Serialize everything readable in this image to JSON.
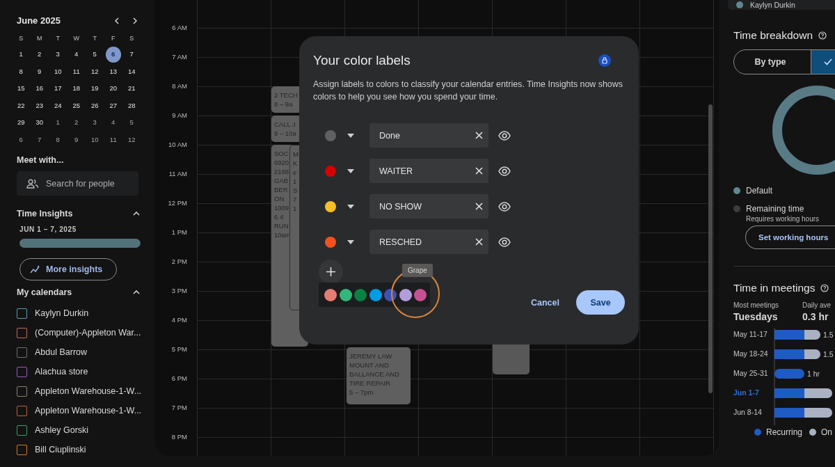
{
  "mini_calendar": {
    "month": "June 2025",
    "weekdays": [
      "S",
      "M",
      "T",
      "W",
      "T",
      "F",
      "S"
    ],
    "days": [
      {
        "label": "1",
        "selected": false,
        "muted": false
      },
      {
        "label": "2",
        "selected": false,
        "muted": false
      },
      {
        "label": "3",
        "selected": false,
        "muted": false
      },
      {
        "label": "4",
        "selected": false,
        "muted": false
      },
      {
        "label": "5",
        "selected": false,
        "muted": false
      },
      {
        "label": "6",
        "selected": true,
        "muted": false
      },
      {
        "label": "7",
        "selected": false,
        "muted": false
      },
      {
        "label": "8",
        "selected": false,
        "muted": false
      },
      {
        "label": "9",
        "selected": false,
        "muted": false
      },
      {
        "label": "10",
        "selected": false,
        "muted": false
      },
      {
        "label": "11",
        "selected": false,
        "muted": false
      },
      {
        "label": "12",
        "selected": false,
        "muted": false
      },
      {
        "label": "13",
        "selected": false,
        "muted": false
      },
      {
        "label": "14",
        "selected": false,
        "muted": false
      },
      {
        "label": "15",
        "selected": false,
        "muted": false
      },
      {
        "label": "16",
        "selected": false,
        "muted": false
      },
      {
        "label": "17",
        "selected": false,
        "muted": false
      },
      {
        "label": "18",
        "selected": false,
        "muted": false
      },
      {
        "label": "19",
        "selected": false,
        "muted": false
      },
      {
        "label": "20",
        "selected": false,
        "muted": false
      },
      {
        "label": "21",
        "selected": false,
        "muted": false
      },
      {
        "label": "22",
        "selected": false,
        "muted": false
      },
      {
        "label": "23",
        "selected": false,
        "muted": false
      },
      {
        "label": "24",
        "selected": false,
        "muted": false
      },
      {
        "label": "25",
        "selected": false,
        "muted": false
      },
      {
        "label": "26",
        "selected": false,
        "muted": false
      },
      {
        "label": "27",
        "selected": false,
        "muted": false
      },
      {
        "label": "28",
        "selected": false,
        "muted": false
      },
      {
        "label": "29",
        "selected": false,
        "muted": false
      },
      {
        "label": "30",
        "selected": false,
        "muted": false
      },
      {
        "label": "1",
        "selected": false,
        "muted": true
      },
      {
        "label": "2",
        "selected": false,
        "muted": true
      },
      {
        "label": "3",
        "selected": false,
        "muted": true
      },
      {
        "label": "4",
        "selected": false,
        "muted": true
      },
      {
        "label": "5",
        "selected": false,
        "muted": true
      },
      {
        "label": "6",
        "selected": false,
        "muted": true
      },
      {
        "label": "7",
        "selected": false,
        "muted": true
      },
      {
        "label": "8",
        "selected": false,
        "muted": true
      },
      {
        "label": "9",
        "selected": false,
        "muted": true
      },
      {
        "label": "10",
        "selected": false,
        "muted": true
      },
      {
        "label": "11",
        "selected": false,
        "muted": true
      },
      {
        "label": "12",
        "selected": false,
        "muted": true
      }
    ]
  },
  "meet_with": {
    "title": "Meet with...",
    "placeholder": "Search for people"
  },
  "time_insights": {
    "title": "Time Insights",
    "expanded": true,
    "range": "JUN 1 – 7, 2025",
    "level": 1,
    "button": "More insights"
  },
  "my_calendars": {
    "title": "My calendars",
    "expanded": true,
    "items": [
      {
        "name": "Kaylyn Durkin",
        "color": "#5e9cb0",
        "checked": false
      },
      {
        "name": "(Computer)-Appleton War...",
        "color": "#c0705a",
        "checked": false
      },
      {
        "name": "Abdul Barrow",
        "color": "#6f6f6f",
        "checked": false
      },
      {
        "name": "Alachua store",
        "color": "#9c5bb8",
        "checked": false
      },
      {
        "name": "Appleton Warehouse-1-W...",
        "color": "#8a8070",
        "checked": false
      },
      {
        "name": "Appleton Warehouse-1-W...",
        "color": "#c0603a",
        "checked": false
      },
      {
        "name": "Ashley Gorski",
        "color": "#3f9a6a",
        "checked": false
      },
      {
        "name": "Bill Ciuplinski",
        "color": "#d07a30",
        "checked": false
      }
    ]
  },
  "time_grid": {
    "hours": [
      "6 AM",
      "7 AM",
      "8 AM",
      "9 AM",
      "10 AM",
      "11 AM",
      "12 PM",
      "1 PM",
      "2 PM",
      "3 PM",
      "4 PM",
      "5 PM",
      "6 PM",
      "7 PM",
      "8 PM"
    ],
    "events": [
      {
        "lines": [
          "2 TECH",
          "8 – 9a"
        ]
      },
      {
        "lines": [
          "CALL J",
          "9 – 10a"
        ]
      },
      {
        "lines": [
          "SOC",
          "6920",
          "2198",
          "GAB",
          "BER",
          "ON",
          "1009",
          "6 4",
          "RUN",
          "10am"
        ]
      },
      {
        "lines": [
          "M",
          "K",
          "e",
          "1",
          "S",
          "7",
          "1"
        ]
      },
      {
        "lines": [
          "JEREMY LAW MOUNT AND BALLANCE AND TIRE REPAIR",
          "5 – 7pm"
        ]
      },
      {
        "kind": "blank"
      }
    ]
  },
  "dialog": {
    "title": "Your color labels",
    "description": "Assign labels to colors to classify your calendar entries. Time Insights now shows colors to help you see how you spend your time.",
    "labels": [
      {
        "color": "#616161",
        "value": "Done"
      },
      {
        "color": "#d50000",
        "value": "WAITER"
      },
      {
        "color": "#f6bf26",
        "value": "NO SHOW"
      },
      {
        "color": "#f4511e",
        "value": "RESCHED"
      }
    ],
    "palette": [
      {
        "color": "#e67c73"
      },
      {
        "color": "#33b679"
      },
      {
        "color": "#0b8043"
      },
      {
        "color": "#039be5"
      },
      {
        "color": "#3f51b5"
      },
      {
        "color": "#b39ddb"
      },
      {
        "color": "#c94f93"
      }
    ],
    "tooltip": "Grape",
    "cancel": "Cancel",
    "save": "Save"
  },
  "right_panel": {
    "calendar_name": "Kaylyn Durkin",
    "time_breakdown": {
      "title": "Time breakdown",
      "segments": [
        {
          "label": "By type",
          "selected": false
        },
        {
          "selected": true
        }
      ],
      "legend": [
        {
          "label": "Default",
          "color": "#5f8791"
        },
        {
          "label": "Remaining time",
          "color": "#3c3c3c",
          "note": "Requires working hours"
        }
      ],
      "button": "Set working hours"
    },
    "time_in_meetings": {
      "title": "Time in meetings",
      "stats": [
        {
          "label": "Most meetings",
          "value": "Tuesdays"
        },
        {
          "label": "Daily ave",
          "value": "0.3 hr"
        }
      ],
      "weeks": [
        {
          "label": "May 11-17",
          "selected": false,
          "reading": "1.5"
        },
        {
          "label": "May 18-24",
          "selected": false,
          "reading": "1.5"
        },
        {
          "label": "May 25-31",
          "selected": false,
          "reading": "1 hr"
        },
        {
          "label": "Jun 1-7",
          "selected": true
        },
        {
          "label": "Jun 8-14",
          "selected": false
        }
      ],
      "legend": [
        {
          "label": "Recurring",
          "color": "#1f5bc4"
        },
        {
          "label": "On",
          "color": "#a9b1c2"
        }
      ]
    }
  }
}
